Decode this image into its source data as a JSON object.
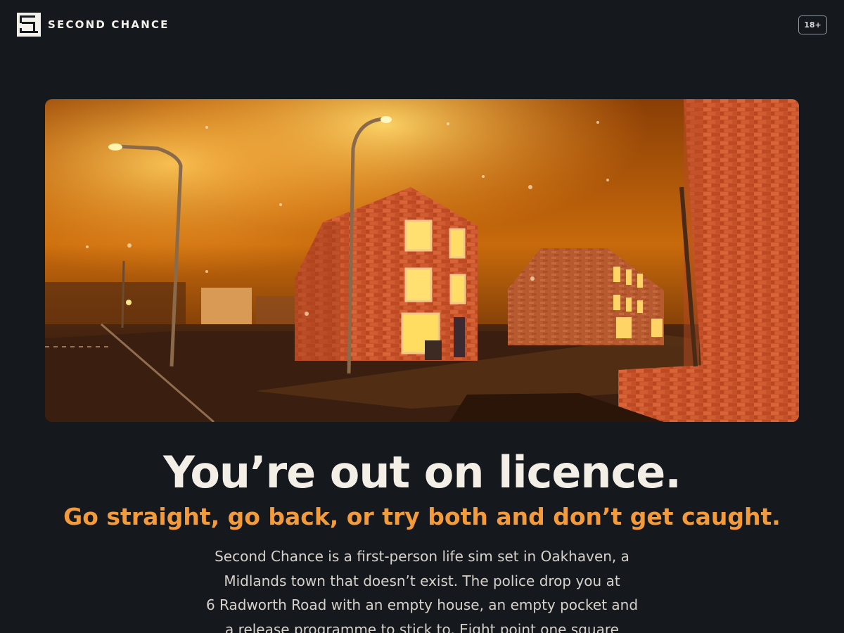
{
  "header": {
    "brand": "SECOND CHANCE",
    "logo_icon": "pixel-s-logo",
    "age_rating": "18+"
  },
  "hero": {
    "scene": "foggy orange-lit street at night with red-brick houses and street lamps"
  },
  "main": {
    "headline": "You’re out on licence.",
    "tagline": "Go straight, go back, or try both and don’t get caught.",
    "description_lines": [
      "Second Chance is a first-person life sim set in Oakhaven, a",
      "Midlands town that doesn’t exist. The police drop you at",
      "6 Radworth Road with an empty house, an empty pocket and",
      "a release programme to stick to. Eight point one square"
    ]
  },
  "colors": {
    "background": "#15181c",
    "accent": "#f39a3b",
    "text": "#f4efe6"
  }
}
